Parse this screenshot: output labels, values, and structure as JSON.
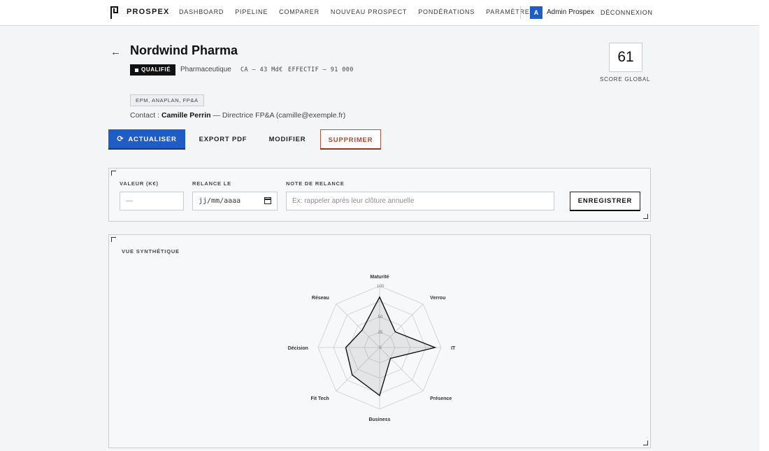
{
  "header": {
    "brand": "PROSPEX",
    "nav": [
      "DASHBOARD",
      "PIPELINE",
      "COMPARER",
      "NOUVEAU PROSPECT",
      "PONDÉRATIONS",
      "PARAMÈTRES"
    ],
    "avatar_initial": "A",
    "user_name": "Admin Prospex",
    "logout_label": "DÉCONNEXION"
  },
  "prospect": {
    "name": "Nordwind Pharma",
    "status": "QUALIFIÉ",
    "sector": "Pharmaceutique",
    "ca": "CA — 43 Md€",
    "effectif": "EFFECTIF — 91 000",
    "score": "61",
    "score_label": "SCORE GLOBAL",
    "tags": "EPM, ANAPLAN, FP&A",
    "contact_prefix": "Contact :",
    "contact_name": "Camille Perrin",
    "contact_detail": "— Directrice FP&A (camille@exemple.fr)"
  },
  "actions": {
    "refresh": "ACTUALISER",
    "export_pdf": "EXPORT PDF",
    "edit": "MODIFIER",
    "delete": "SUPPRIMER"
  },
  "form": {
    "valeur_label": "VALEUR (K€)",
    "valeur_placeholder": "—",
    "relance_label": "RELANCE LE",
    "relance_placeholder": "jj/mm/aaaa",
    "note_label": "NOTE DE RELANCE",
    "note_placeholder": "Ex: rappeler après leur clôture annuelle",
    "save_label": "ENREGISTRER"
  },
  "chart_data": {
    "type": "radar",
    "title": "VUE SYNTHÉTIQUE",
    "axes": [
      "Maturité",
      "Verrou",
      "IT",
      "Présence",
      "Business",
      "Fit Tech",
      "Décision",
      "Réseau"
    ],
    "values": [
      82,
      36,
      90,
      25,
      78,
      63,
      55,
      40
    ],
    "range": [
      0,
      100
    ],
    "ticks": [
      0,
      25,
      50,
      75,
      100
    ],
    "tick_labels": [
      "0",
      "25",
      "50",
      "",
      "100"
    ]
  },
  "colors": {
    "accent": "#1f5cc4",
    "danger": "#b04a32"
  }
}
